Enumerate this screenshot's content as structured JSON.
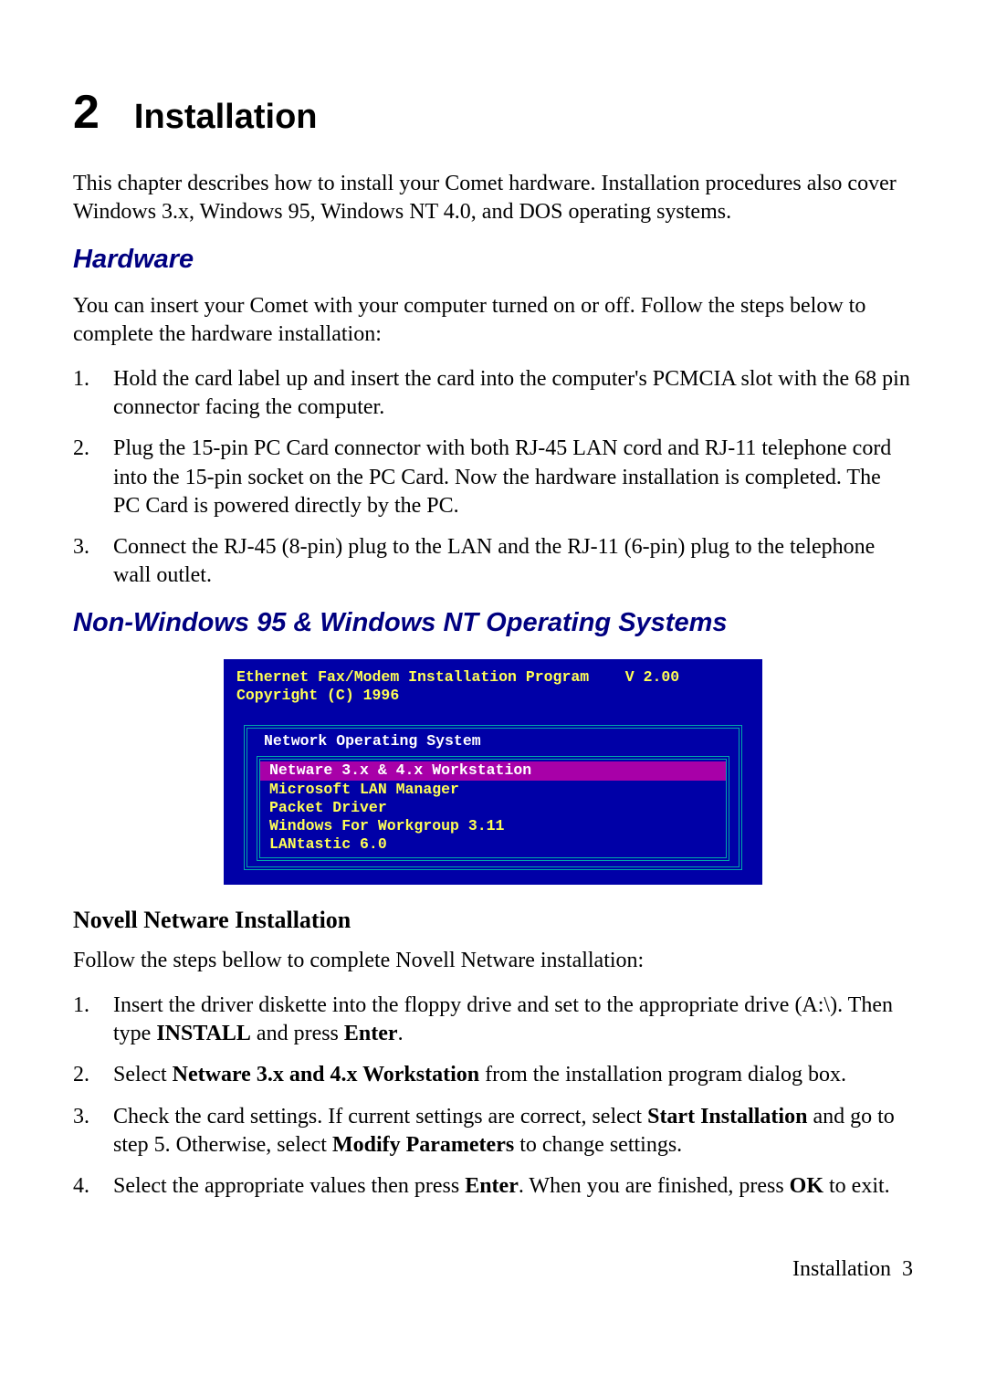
{
  "chapter": {
    "number": "2",
    "title": "Installation"
  },
  "intro": "This chapter describes how to install your Comet hardware. Installation procedures also cover Windows 3.x, Windows 95, Windows NT 4.0, and DOS operating systems.",
  "hardware": {
    "heading": "Hardware",
    "intro": "You can insert your Comet with your computer turned on or off. Follow the steps below to complete the hardware installation:",
    "steps": [
      "Hold the card label up and insert the card into the computer's PCMCIA slot with the 68 pin connector facing the computer.",
      "Plug the 15-pin PC Card connector with both RJ-45 LAN cord and RJ-11 telephone cord into the 15-pin socket on the PC Card. Now the hardware installation is completed. The PC Card is powered directly by the PC.",
      "Connect the RJ-45 (8-pin) plug to the LAN and the RJ-11 (6-pin) plug to the telephone wall outlet."
    ]
  },
  "nonwin": {
    "heading": "Non-Windows 95 & Windows NT Operating Systems",
    "terminal": {
      "line1": "Ethernet Fax/Modem Installation Program    V 2.00",
      "line2": "Copyright (C) 1996",
      "panelTitle": "Network Operating System",
      "options": [
        "Netware 3.x & 4.x Workstation",
        "Microsoft LAN Manager",
        "Packet Driver",
        "Windows For Workgroup 3.11",
        "LANtastic 6.0"
      ]
    },
    "novell": {
      "heading": "Novell Netware Installation",
      "intro": "Follow the steps bellow to complete Novell Netware installation:",
      "steps": {
        "s1a": "Insert the driver diskette into the floppy drive and set to the appropriate drive (A:\\). Then type ",
        "s1b": "INSTALL",
        "s1c": " and press ",
        "s1d": "Enter",
        "s1e": ".",
        "s2a": "Select ",
        "s2b": "Netware 3.x and 4.x Workstation",
        "s2c": " from the installation program dialog box.",
        "s3a": "Check the card settings. If current settings are correct, select ",
        "s3b": "Start Installation",
        "s3c": " and go to step 5. Otherwise, select ",
        "s3d": "Modify Parameters",
        "s3e": " to change settings.",
        "s4a": "Select the appropriate values then press ",
        "s4b": "Enter",
        "s4c": ". When you are finished,   press ",
        "s4d": "OK",
        "s4e": " to exit."
      }
    }
  },
  "footer": {
    "label": "Installation",
    "page": "3"
  }
}
